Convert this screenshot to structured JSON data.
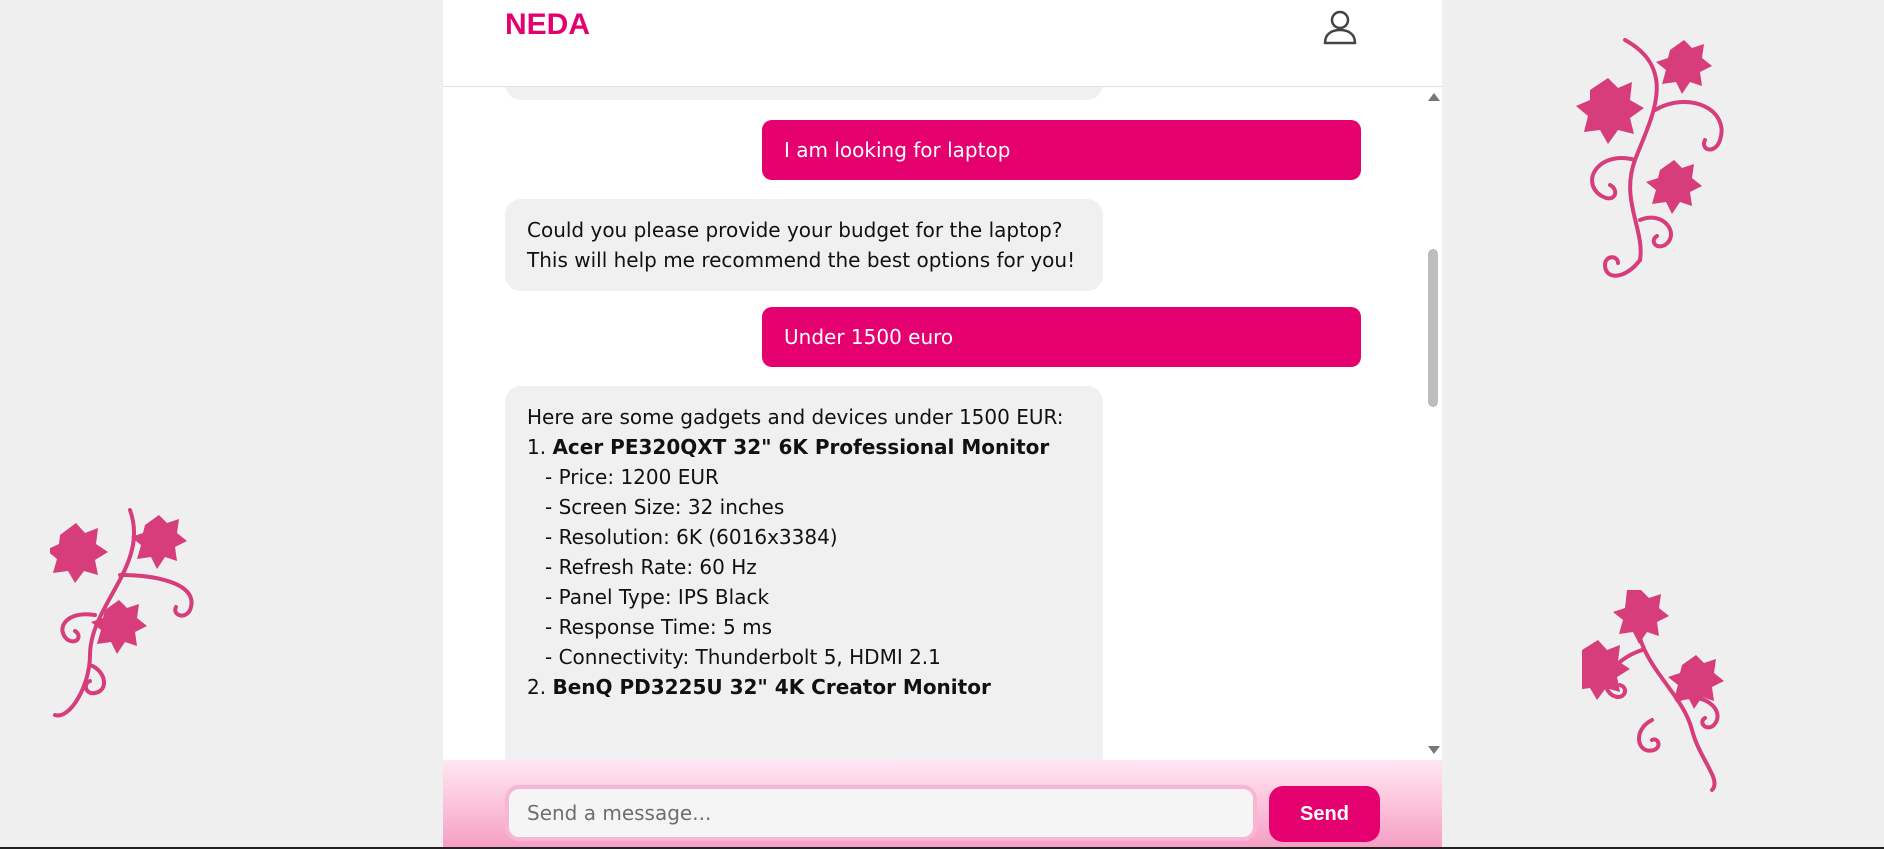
{
  "app": {
    "brand": "NEDA"
  },
  "colors": {
    "accent": "#e5006f",
    "bot_bubble": "#f0f0f0",
    "vine": "#d63d7a"
  },
  "header": {
    "user_icon": "user-icon"
  },
  "messages": [
    {
      "role": "user",
      "text": "I am looking for laptop"
    },
    {
      "role": "assistant",
      "text": "Could you please provide your budget for the laptop? This will help me recommend the best options for you!"
    },
    {
      "role": "user",
      "text": "Under 1500 euro"
    },
    {
      "role": "assistant",
      "intro": "Here are some gadgets and devices under 1500 EUR:",
      "items": [
        {
          "number": "1.",
          "name": "Acer PE320QXT 32\" 6K Professional Monitor",
          "specs": [
            "- Price: 1200 EUR",
            "- Screen Size: 32 inches",
            "- Resolution: 6K (6016x3384)",
            "- Refresh Rate: 60 Hz",
            "- Panel Type: IPS Black",
            "- Response Time: 5 ms",
            "- Connectivity: Thunderbolt 5, HDMI 2.1"
          ]
        },
        {
          "number": "2.",
          "name": "BenQ PD3225U 32\" 4K Creator Monitor"
        }
      ]
    }
  ],
  "composer": {
    "placeholder": "Send a message...",
    "send_label": "Send"
  }
}
